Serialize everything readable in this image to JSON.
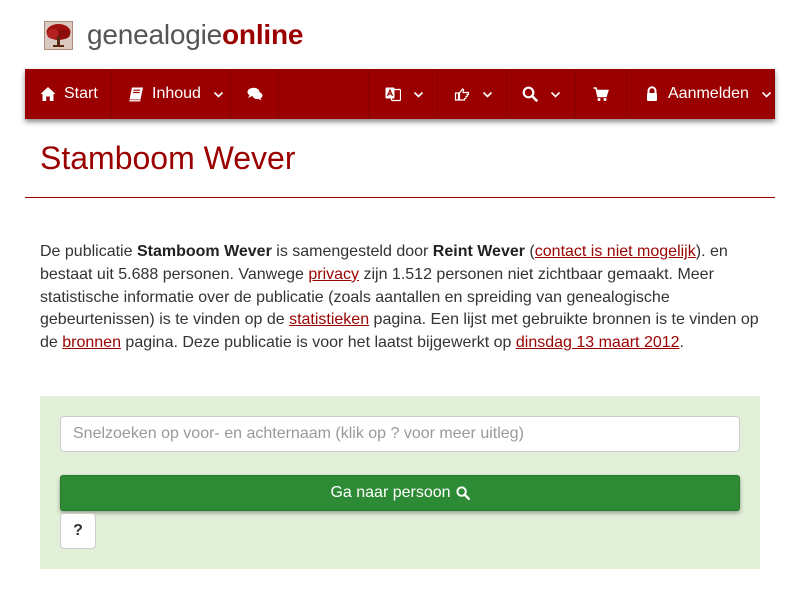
{
  "brand": {
    "part1": "genealogie",
    "part2": "online",
    "logo_icon": "tree-icon"
  },
  "colors": {
    "accent": "#9b0000",
    "panel_bg": "#e2f0d9",
    "button_green": "#2e8b35"
  },
  "nav": {
    "start_label": "Start",
    "inhoud_label": "Inhoud",
    "login_label": "Aanmelden",
    "icons": [
      "home-icon",
      "book-icon",
      "comments-icon",
      "language-icon",
      "hand-point-icon",
      "search-icon",
      "cart-icon",
      "lock-icon"
    ]
  },
  "page": {
    "title": "Stamboom Wever"
  },
  "intro": {
    "t1": "De publicatie ",
    "pub_name": "Stamboom Wever",
    "t2": " is samengesteld door ",
    "author": "Reint Wever",
    "t3": " (",
    "contact_link": "contact is niet mogelijk",
    "t4": "). en bestaat uit 5.688 personen. Vanwege ",
    "privacy_link": "privacy",
    "t5": " zijn 1.512 personen niet zichtbaar gemaakt. Meer statistische informatie over de publicatie (zoals aantallen en spreiding van genealogische gebeurtenissen) is te vinden op de ",
    "stats_link": "statistieken",
    "t6": " pagina. Een lijst met gebruikte bronnen is te vinden op de ",
    "sources_link": "bronnen",
    "t7": " pagina. Deze publicatie is voor het laatst bijgewerkt op ",
    "date_link": "dinsdag 13 maart 2012",
    "t8": "."
  },
  "search": {
    "placeholder": "Snelzoeken op voor- en achternaam (klik op ? voor meer uitleg)",
    "go_label": "Ga naar persoon",
    "help_label": "?"
  }
}
